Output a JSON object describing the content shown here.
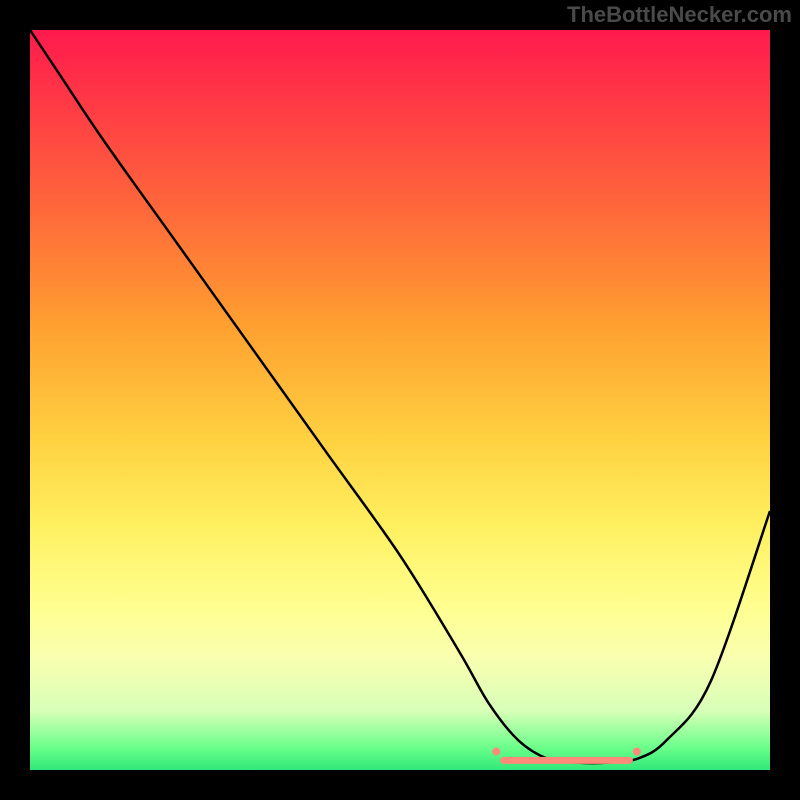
{
  "watermark": "TheBottleNecker.com",
  "chart_data": {
    "type": "line",
    "title": "",
    "xlabel": "",
    "ylabel": "",
    "xlim": [
      0,
      100
    ],
    "ylim": [
      0,
      100
    ],
    "grid": false,
    "legend": false,
    "series": [
      {
        "name": "curve",
        "x": [
          0,
          4,
          10,
          20,
          30,
          40,
          50,
          58,
          62,
          66,
          70,
          74,
          78,
          82,
          86,
          92,
          100
        ],
        "y": [
          100,
          94,
          85,
          71,
          57,
          43,
          29,
          16,
          9,
          4,
          1.5,
          1,
          1,
          1.5,
          4,
          12,
          35
        ],
        "color": "#000000"
      }
    ],
    "markers": [
      {
        "name": "range-dot-left",
        "x": 63,
        "y": 2.5,
        "color": "#ff8a7a",
        "size": 8
      },
      {
        "name": "range-dot-right",
        "x": 82,
        "y": 2.5,
        "color": "#ff8a7a",
        "size": 8
      }
    ],
    "highlight_band": {
      "x_start": 64,
      "x_end": 81,
      "y": 1.3,
      "color": "#ff8a7a",
      "thickness": 7
    }
  }
}
